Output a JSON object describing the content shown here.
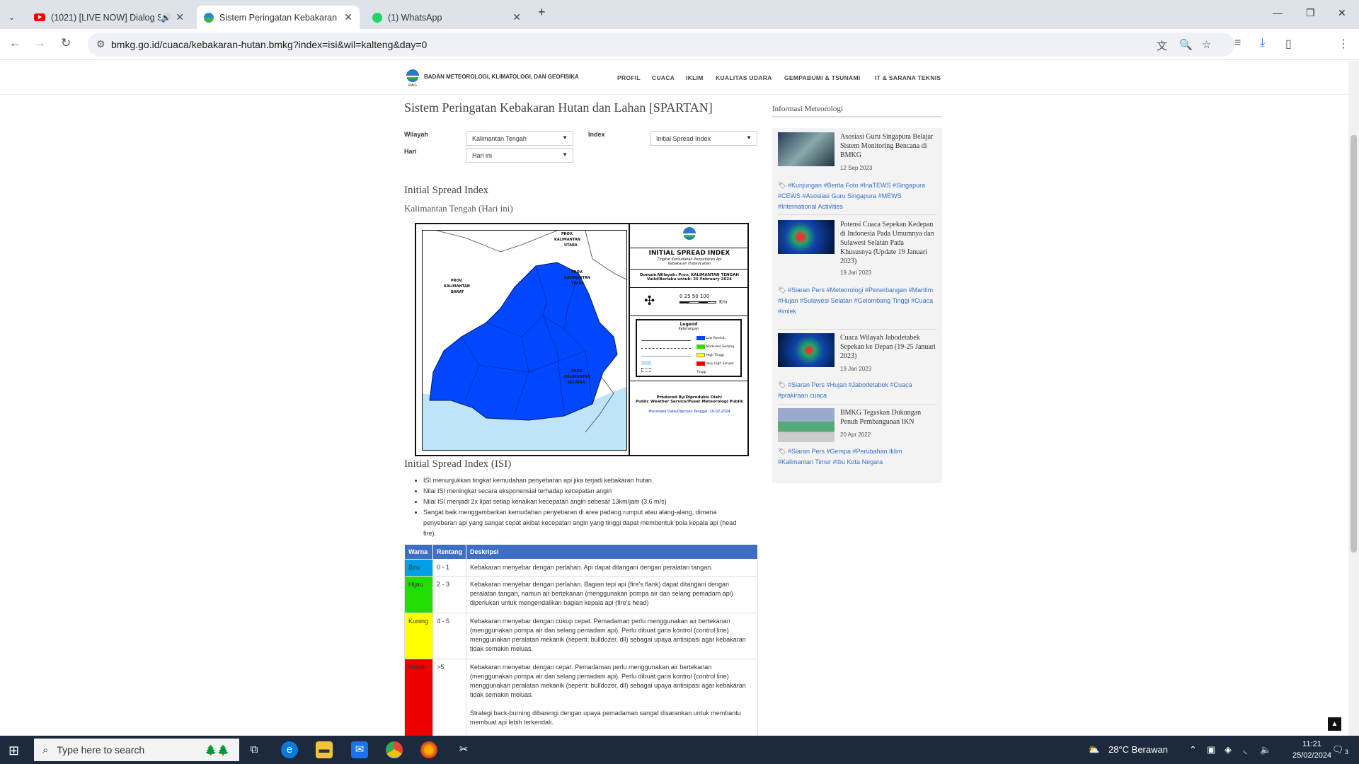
{
  "browser": {
    "tabs": [
      {
        "title": "(1021) [LIVE NOW] Dialog S",
        "icon": "youtube-icon"
      },
      {
        "title": "Sistem Peringatan Kebakaran H",
        "icon": "bmkg-icon"
      },
      {
        "title": "(1) WhatsApp",
        "icon": "whatsapp-icon"
      }
    ],
    "url": "bmkg.go.id/cuaca/kebakaran-hutan.bmkg?index=isi&wil=kalteng&day=0"
  },
  "site": {
    "org_name": "BADAN METEOROLOGI, KLIMATOLOGI, DAN GEOFISIKA",
    "menu": [
      "PROFIL",
      "CUACA",
      "IKLIM",
      "KUALITAS UDARA",
      "GEMPABUMI & TSUNAMI",
      "IT & SARANA TEKNIS"
    ]
  },
  "main": {
    "title": "Sistem Peringatan Kebakaran Hutan dan Lahan [SPARTAN]",
    "filters": {
      "wilayah_label": "Wilayah",
      "wilayah_value": "Kalimantan Tengah",
      "hari_label": "Hari",
      "hari_value": "Hari ini",
      "index_label": "Index",
      "index_value": "Initial Spread Index"
    },
    "section_title": "Initial Spread Index",
    "section_subtitle": "Kalimantan Tengah (Hari ini)",
    "map": {
      "heading": "INITIAL SPREAD INDEX",
      "subheading": "Tingkat Kemudahan Penyebaran Api Kebakaran Hutan/Lahan",
      "domain_line": "Domain/Wilayah: Prov. KALIMANTAN TENGAH",
      "valid_line": "Valid/Berlaku untuk: 25 February 2024",
      "scale": "0 25 50 100",
      "scale_unit": "Km",
      "legend_title": "Legend",
      "legend_subtitle": "Keterangan",
      "legend_items": [
        "Low Rendah",
        "Moderate Sedang",
        "High Tinggi",
        "Very High Sangat Tinggi"
      ],
      "produced_by": "Produced By/Diproduksi Oleh:",
      "producer": "Public Weather Service/Pusat Meteorologi Publik",
      "processed": "Processed Date/Diproses Tanggal: 20-02-2024",
      "region_labels": [
        "PROV. KALIMANTAN BARAT",
        "PROV. KALIMANTAN TIMUR",
        "PROV. KALIMANTAN SELATAN",
        "PROV. KALIMANTAN UTARA"
      ],
      "index_level": "Low"
    },
    "isi_title": "Initial Spread Index (ISI)",
    "bullets": [
      "ISI menunjukkan tingkat kemudahan penyebaran api jika terjadi kebakaran hutan.",
      "Nilai ISI meningkat secara eksponensial terhadap kecepatan angin",
      "Nilai ISI menjadi 2x lipat setiap kenaikan kecepatan angin sebesar 13km/jam (3.6 m/s)",
      "Sangat baik menggambarkan kemudahan penyebaran di area padang rumput atau alang-alang, dimana penyebaran api yang sangat cepat akibat kecepatan angin yang tinggi dapat membentuk pola kepala api (head fire)."
    ],
    "table": {
      "headers": [
        "Warna",
        "Rentang",
        "Deskripsi"
      ],
      "rows": [
        {
          "warna": "Biru",
          "color": "#00a0e9",
          "rentang": "0 - 1",
          "deskripsi": "Kebakaran menyebar dengan perlahan. Api dapat ditangani dengan peralatan tangan."
        },
        {
          "warna": "Hijau",
          "color": "#22dd00",
          "rentang": "2 - 3",
          "deskripsi": "Kebakaran menyebar dengan perlahan. Bagian tepi api (fire's flank) dapat ditangani dengan peralatan tangan, namun air bertekanan (menggunakan pompa air dan selang pemadam api) diperlukan untuk mengendalikan bagian kepala api (fire's head)"
        },
        {
          "warna": "Kuning",
          "color": "#ffff00",
          "rentang": "4 - 5",
          "deskripsi": "Kebakaran menyebar dengan cukup cepat. Pemadaman perlu menggunakan air bertekanan (menggunakan pompa air dan selang pemadam api). Perlu dibuat garis kontrol (control line) menggunakan peralatan mekanik (seperti: bulldozer, dll) sebagai upaya antisipasi agar kebakaran tidak semakin meluas."
        },
        {
          "warna": "Merah",
          "color": "#ee0000",
          "rentang": ">5",
          "deskripsi": "Kebakaran menyebar dengan cepat. Pemadaman perlu menggunakan air bertekanan (menggunakan pompa air dan selang pemadam api). Perlu dibuat garis kontrol (control line) menggunakan peralatan mekanik (seperti: bulldozer, dll) sebagai upaya antisipasi agar kebakaran tidak semakin meluas.",
          "deskripsi2": "Strategi back-burning dibarengi dengan upaya pemadaman sangat disarankan untuk membantu membuat api lebih terkendali."
        }
      ]
    }
  },
  "sidebar": {
    "heading": "Informasi Meteorologi",
    "news": [
      {
        "title": "Asosiasi Guru Singapura Belajar Sistem Monitoring Bencana di BMKG",
        "date": "12 Sep 2023",
        "tags": "#Kunjungan #Berita Foto #InaTEWS #Singapura #CEWS #Asosiasi Guru Singapura #MEWS #International Activities"
      },
      {
        "title": "Potensi Cuaca Sepekan Kedepan di Indonesia Pada Umumnya dan Sulawesi Selatan Pada Khususnya (Update 19 Januari 2023)",
        "date": "19 Jan 2023",
        "tags": "#Siaran Pers #Meteorologi #Penerbangan #Maritim #Hujan #Sulawesi Selatan #Gelombang Tinggi #Cuaca #imlek"
      },
      {
        "title": "Cuaca Wilayah Jabodetabek Sepekan ke Depan (19-25 Januari 2023)",
        "date": "19 Jan 2023",
        "tags": "#Siaran Pers #Hujan #Jabodetabek #Cuaca #prakiraan cuaca"
      },
      {
        "title": "BMKG Tegaskan Dukungan Penuh Pembangunan IKN",
        "date": "20 Apr 2022",
        "tags": "#Siaran Pers #Gempa #Perubahan Iklim #Kalimantan Timur #Ibu Kota Negara"
      }
    ]
  },
  "taskbar": {
    "search_placeholder": "Type here to search",
    "weather": "28°C  Berawan",
    "time": "11:21",
    "date": "25/02/2024",
    "notif_count": "3"
  }
}
